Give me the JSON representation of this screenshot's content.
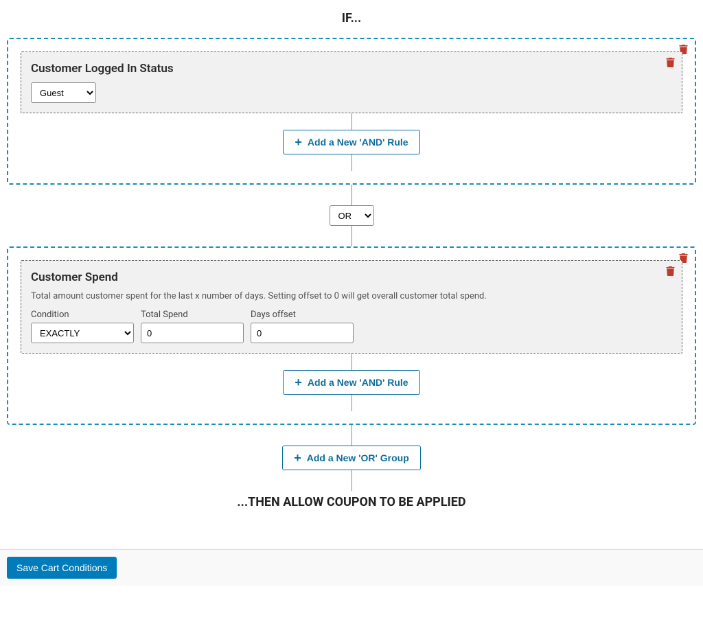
{
  "heading_if": "IF...",
  "heading_then": "...THEN ALLOW COUPON TO BE APPLIED",
  "groups": [
    {
      "rules": [
        {
          "title": "Customer Logged In Status",
          "desc": "",
          "fields": [
            {
              "label": "",
              "type": "select",
              "value": "Guest",
              "width": "sm"
            }
          ]
        }
      ],
      "add_and_label": "Add a New 'AND' Rule"
    },
    {
      "rules": [
        {
          "title": "Customer Spend",
          "desc": "Total amount customer spent for the last x number of days. Setting offset to 0 will get overall customer total spend.",
          "fields": [
            {
              "label": "Condition",
              "type": "select",
              "value": "EXACTLY",
              "width": "md"
            },
            {
              "label": "Total Spend",
              "type": "text",
              "value": "0",
              "width": "md"
            },
            {
              "label": "Days offset",
              "type": "text",
              "value": "0",
              "width": "md"
            }
          ]
        }
      ],
      "add_and_label": "Add a New 'AND' Rule"
    }
  ],
  "logic_operator": "OR",
  "add_or_label": "Add a New 'OR' Group",
  "save_button": "Save Cart Conditions"
}
